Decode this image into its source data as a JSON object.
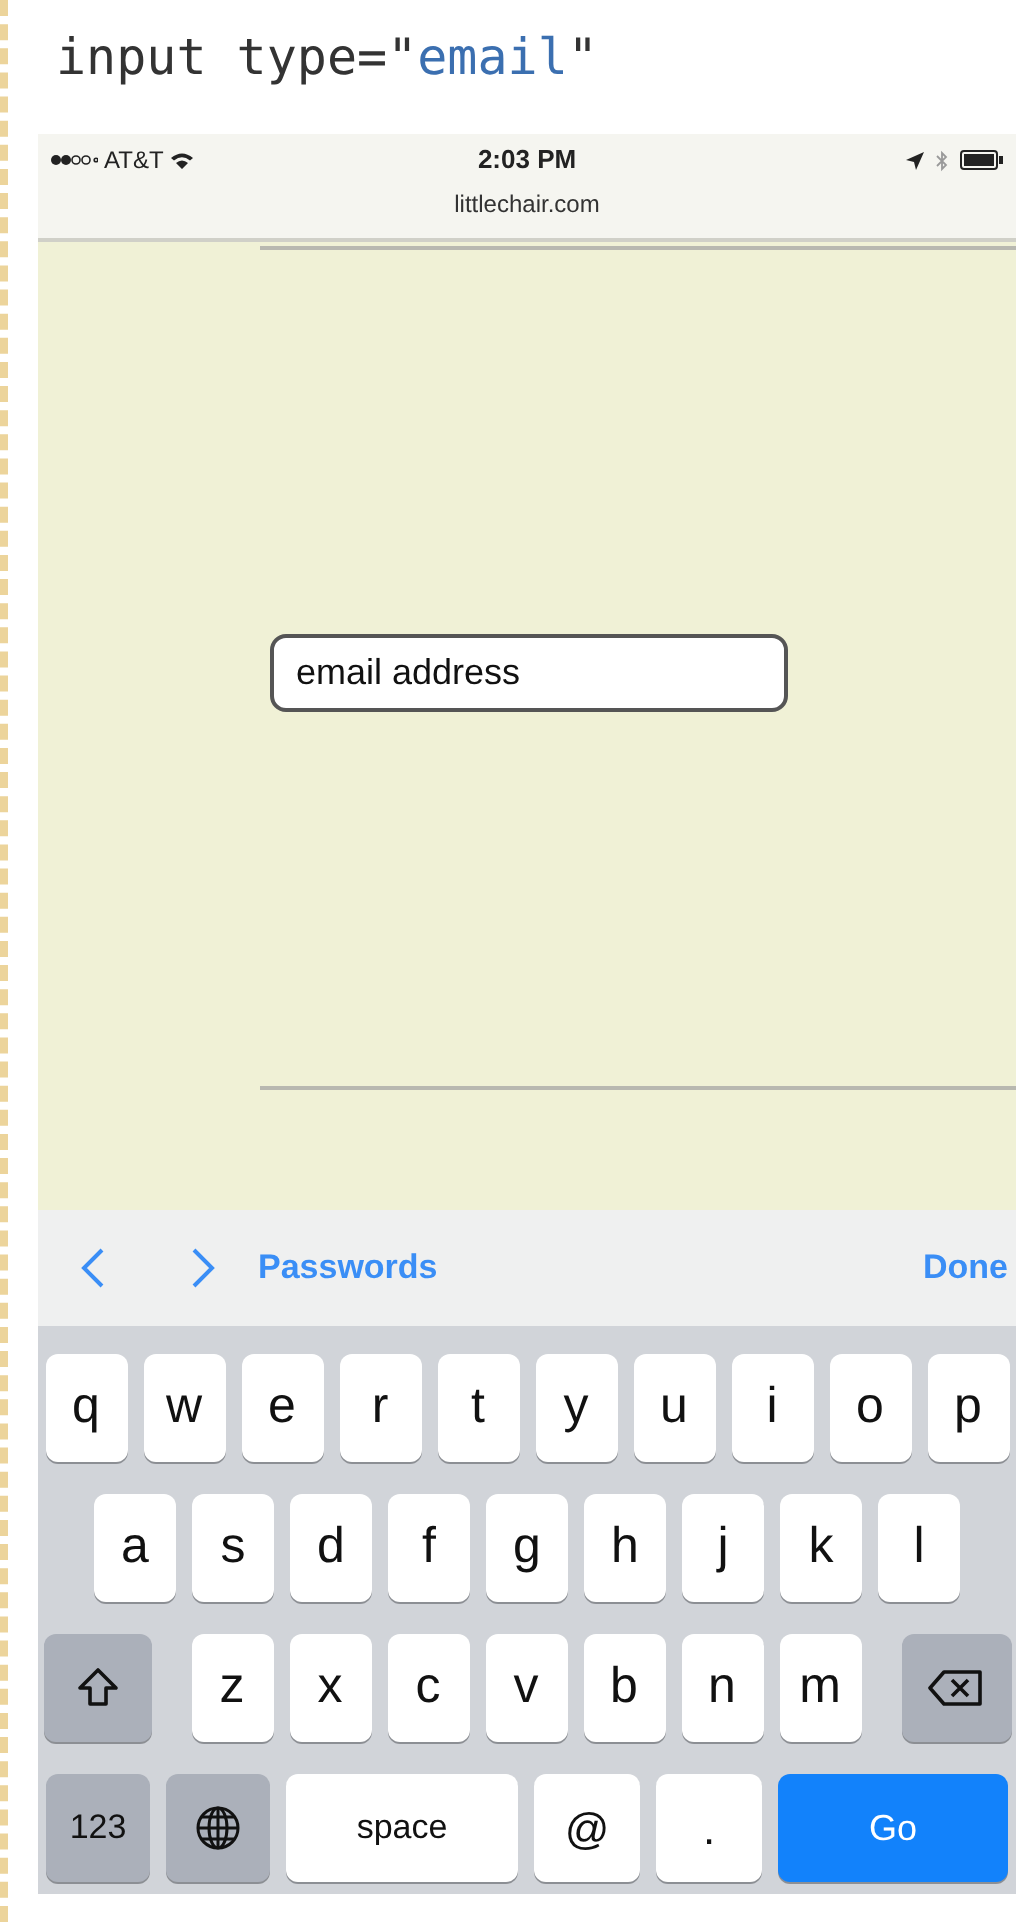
{
  "heading": {
    "segments": [
      {
        "kind": "code",
        "text": "input type=\""
      },
      {
        "kind": "string",
        "text": "email"
      },
      {
        "kind": "code",
        "text": "\""
      }
    ]
  },
  "status_bar": {
    "carrier": "AT&T",
    "time": "2:03 PM",
    "url": "littlechair.com"
  },
  "page": {
    "email_field": {
      "value": "email address"
    }
  },
  "accessory_bar": {
    "link": "Passwords",
    "done": "Done"
  },
  "keyboard": {
    "rows": [
      {
        "keys": [
          {
            "kind": "letter",
            "label": "q"
          },
          {
            "kind": "letter",
            "label": "w"
          },
          {
            "kind": "letter",
            "label": "e"
          },
          {
            "kind": "letter",
            "label": "r"
          },
          {
            "kind": "letter",
            "label": "t"
          },
          {
            "kind": "letter",
            "label": "y"
          },
          {
            "kind": "letter",
            "label": "u"
          },
          {
            "kind": "letter",
            "label": "i"
          },
          {
            "kind": "letter",
            "label": "o"
          },
          {
            "kind": "letter",
            "label": "p"
          }
        ]
      },
      {
        "keys": [
          {
            "kind": "letter",
            "label": "a"
          },
          {
            "kind": "letter",
            "label": "s"
          },
          {
            "kind": "letter",
            "label": "d"
          },
          {
            "kind": "letter",
            "label": "f"
          },
          {
            "kind": "letter",
            "label": "g"
          },
          {
            "kind": "letter",
            "label": "h"
          },
          {
            "kind": "letter",
            "label": "j"
          },
          {
            "kind": "letter",
            "label": "k"
          },
          {
            "kind": "letter",
            "label": "l"
          }
        ]
      },
      {
        "keys": [
          {
            "kind": "shift"
          },
          {
            "kind": "letter",
            "label": "z"
          },
          {
            "kind": "letter",
            "label": "x"
          },
          {
            "kind": "letter",
            "label": "c"
          },
          {
            "kind": "letter",
            "label": "v"
          },
          {
            "kind": "letter",
            "label": "b"
          },
          {
            "kind": "letter",
            "label": "n"
          },
          {
            "kind": "letter",
            "label": "m"
          },
          {
            "kind": "backspace"
          }
        ]
      },
      {
        "keys": [
          {
            "kind": "numbers",
            "label": "123"
          },
          {
            "kind": "globe"
          },
          {
            "kind": "space",
            "label": "space"
          },
          {
            "kind": "symbol",
            "label": "@"
          },
          {
            "kind": "symbol",
            "label": "."
          },
          {
            "kind": "go",
            "label": "Go"
          }
        ]
      }
    ]
  }
}
